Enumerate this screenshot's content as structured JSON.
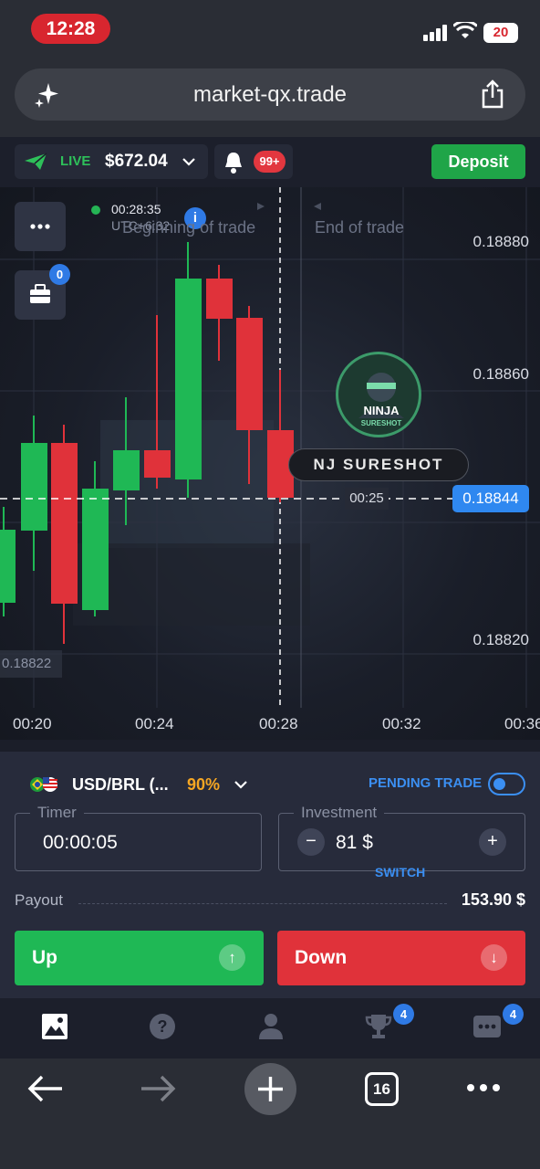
{
  "status_bar": {
    "time": "12:28",
    "battery": "20"
  },
  "browser": {
    "url": "market-qx.trade",
    "tab_count": "16"
  },
  "header": {
    "account_mode": "LIVE",
    "balance": "$672.04",
    "notifications": "99+",
    "deposit_label": "Deposit"
  },
  "chart": {
    "timestamp": "00:28:35",
    "timezone": "UTC+6:32",
    "beginning_label": "Beginning of trade",
    "end_label": "End of trade",
    "open_trades": "0",
    "current_price": "0.18844",
    "countdown": "00:25",
    "low_price": "0.18822",
    "brand_name": "NJ SURESHOT"
  },
  "chart_data": {
    "type": "candlestick",
    "y_ticks": [
      "0.18880",
      "0.18860",
      "0.18820"
    ],
    "x_ticks": [
      "00:20",
      "00:24",
      "00:28",
      "00:32",
      "00:36"
    ],
    "current_price": 0.18844
  },
  "panel": {
    "pair": "USD/BRL (...",
    "payout_pct": "90%",
    "pending_label": "PENDING TRADE",
    "timer_label": "Timer",
    "timer_value": "00:00:05",
    "investment_label": "Investment",
    "investment_value": "81 $",
    "switch_label": "SWITCH",
    "payout_label": "Payout",
    "payout_value": "153.90 $",
    "up_label": "Up",
    "down_label": "Down"
  },
  "app_nav": {
    "trophy_badge": "4",
    "chat_badge": "4"
  },
  "colors": {
    "up": "#1fb855",
    "down": "#e0323a",
    "accent": "#2f88f0",
    "live": "#2ec05a",
    "payout_pct": "#f5a623"
  }
}
